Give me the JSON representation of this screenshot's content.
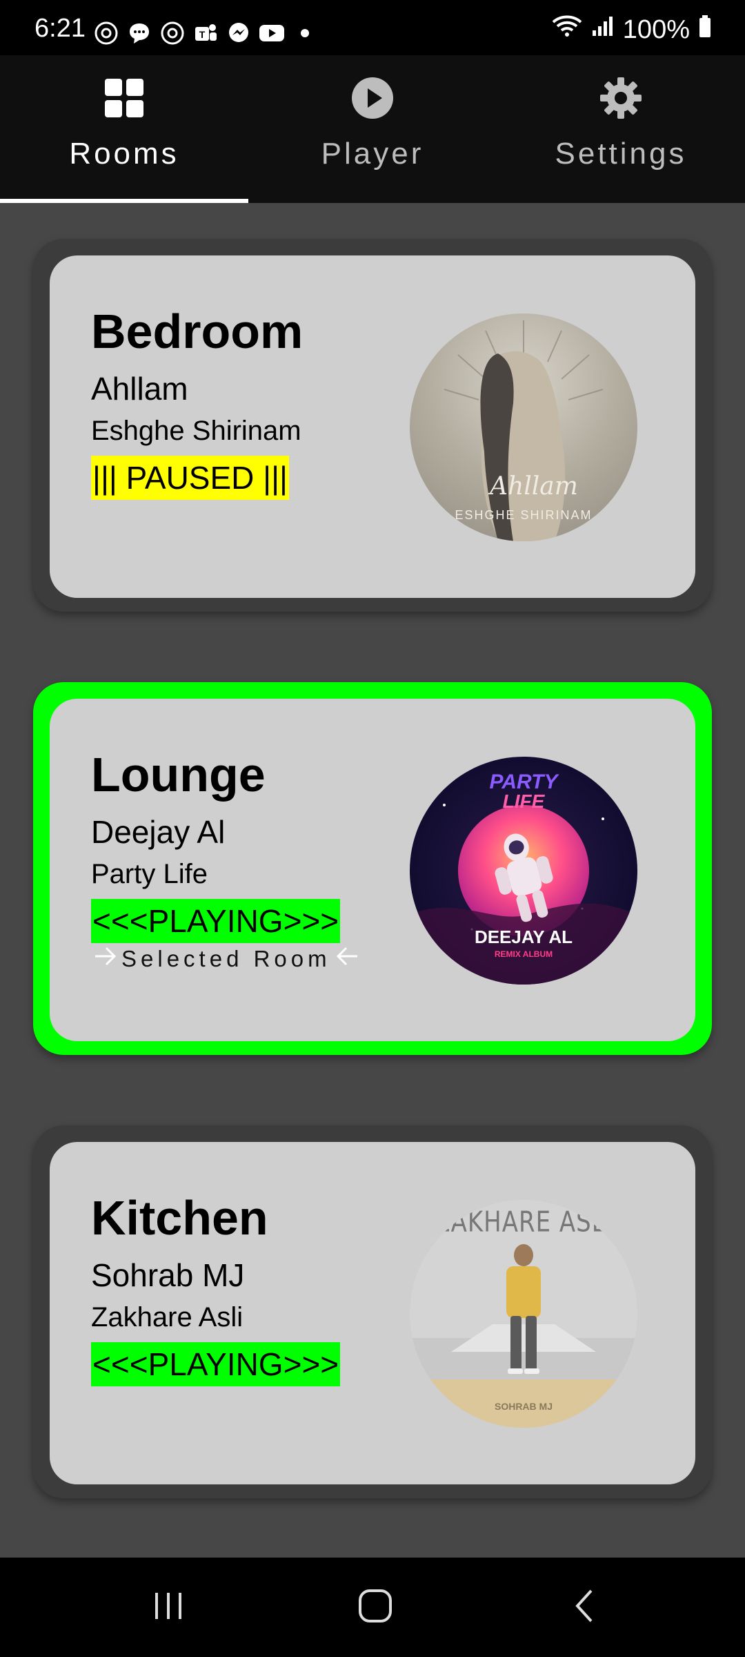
{
  "status_bar": {
    "time": "6:21",
    "battery": "100%",
    "notification_icons": [
      "threads-icon",
      "chat-bubble-icon",
      "threads-icon",
      "teams-icon",
      "messenger-icon",
      "youtube-icon",
      "dot-icon"
    ]
  },
  "tabs": [
    {
      "label": "Rooms",
      "icon": "grid-icon",
      "active": true
    },
    {
      "label": "Player",
      "icon": "play-circle-icon",
      "active": false
    },
    {
      "label": "Settings",
      "icon": "gear-icon",
      "active": false
    }
  ],
  "rooms": [
    {
      "name": "Bedroom",
      "artist": "Ahllam",
      "track": "Eshghe Shirinam",
      "status": "||| PAUSED |||",
      "status_color": "#ffff00",
      "selected": false,
      "album_text": [
        "Ahllam",
        "ESHGHE SHIRINAM"
      ]
    },
    {
      "name": "Lounge",
      "artist": "Deejay Al",
      "track": "Party Life",
      "status": "<<<PLAYING>>>",
      "status_color": "#00ff00",
      "selected": true,
      "selected_label": "Selected Room",
      "album_text": [
        "PARTY",
        "LIFE",
        "DEEJAY AL",
        "REMIX ALBUM"
      ]
    },
    {
      "name": "Kitchen",
      "artist": "Sohrab MJ",
      "track": "Zakhare Asli",
      "status": "<<<PLAYING>>>",
      "status_color": "#00ff00",
      "selected": false,
      "album_text": [
        "ZAKHARE ASLI",
        "SOHRAB MJ"
      ]
    }
  ],
  "nav_bar": {
    "buttons": [
      "recents-icon",
      "home-icon",
      "back-icon"
    ]
  },
  "colors": {
    "background": "#474747",
    "card": "#cfcfcf",
    "selected_border": "#00ff00",
    "paused": "#ffff00",
    "playing": "#00ff00"
  }
}
